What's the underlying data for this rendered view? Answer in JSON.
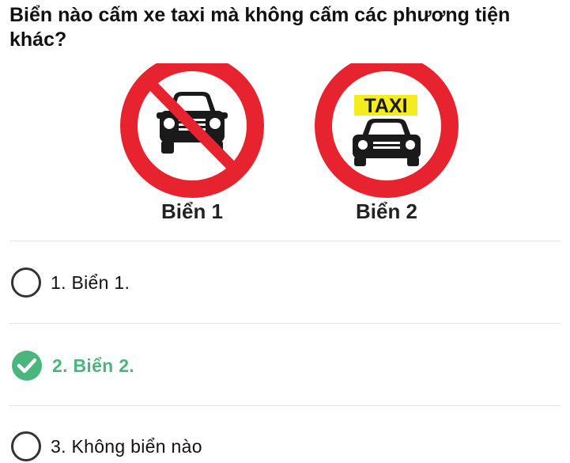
{
  "question": {
    "text": "Biển nào cấm xe taxi mà không cấm các phương tiện khác?"
  },
  "signs": [
    {
      "caption": "Biển 1",
      "icon": "no-car-sign-icon"
    },
    {
      "caption": "Biển 2",
      "icon": "no-taxi-sign-icon",
      "badge": "TAXI"
    }
  ],
  "options": [
    {
      "label": "1. Biển 1.",
      "selected": false,
      "icon": "radio-empty-icon"
    },
    {
      "label": "2. Biển 2.",
      "selected": true,
      "icon": "check-circle-icon"
    },
    {
      "label": "3. Không biển nào",
      "selected": false,
      "icon": "radio-empty-icon"
    }
  ],
  "colors": {
    "sign_red": "#e6232f",
    "selected_green": "#4bb57e",
    "text": "#111111",
    "taxi_yellow": "#f4ec1c"
  }
}
